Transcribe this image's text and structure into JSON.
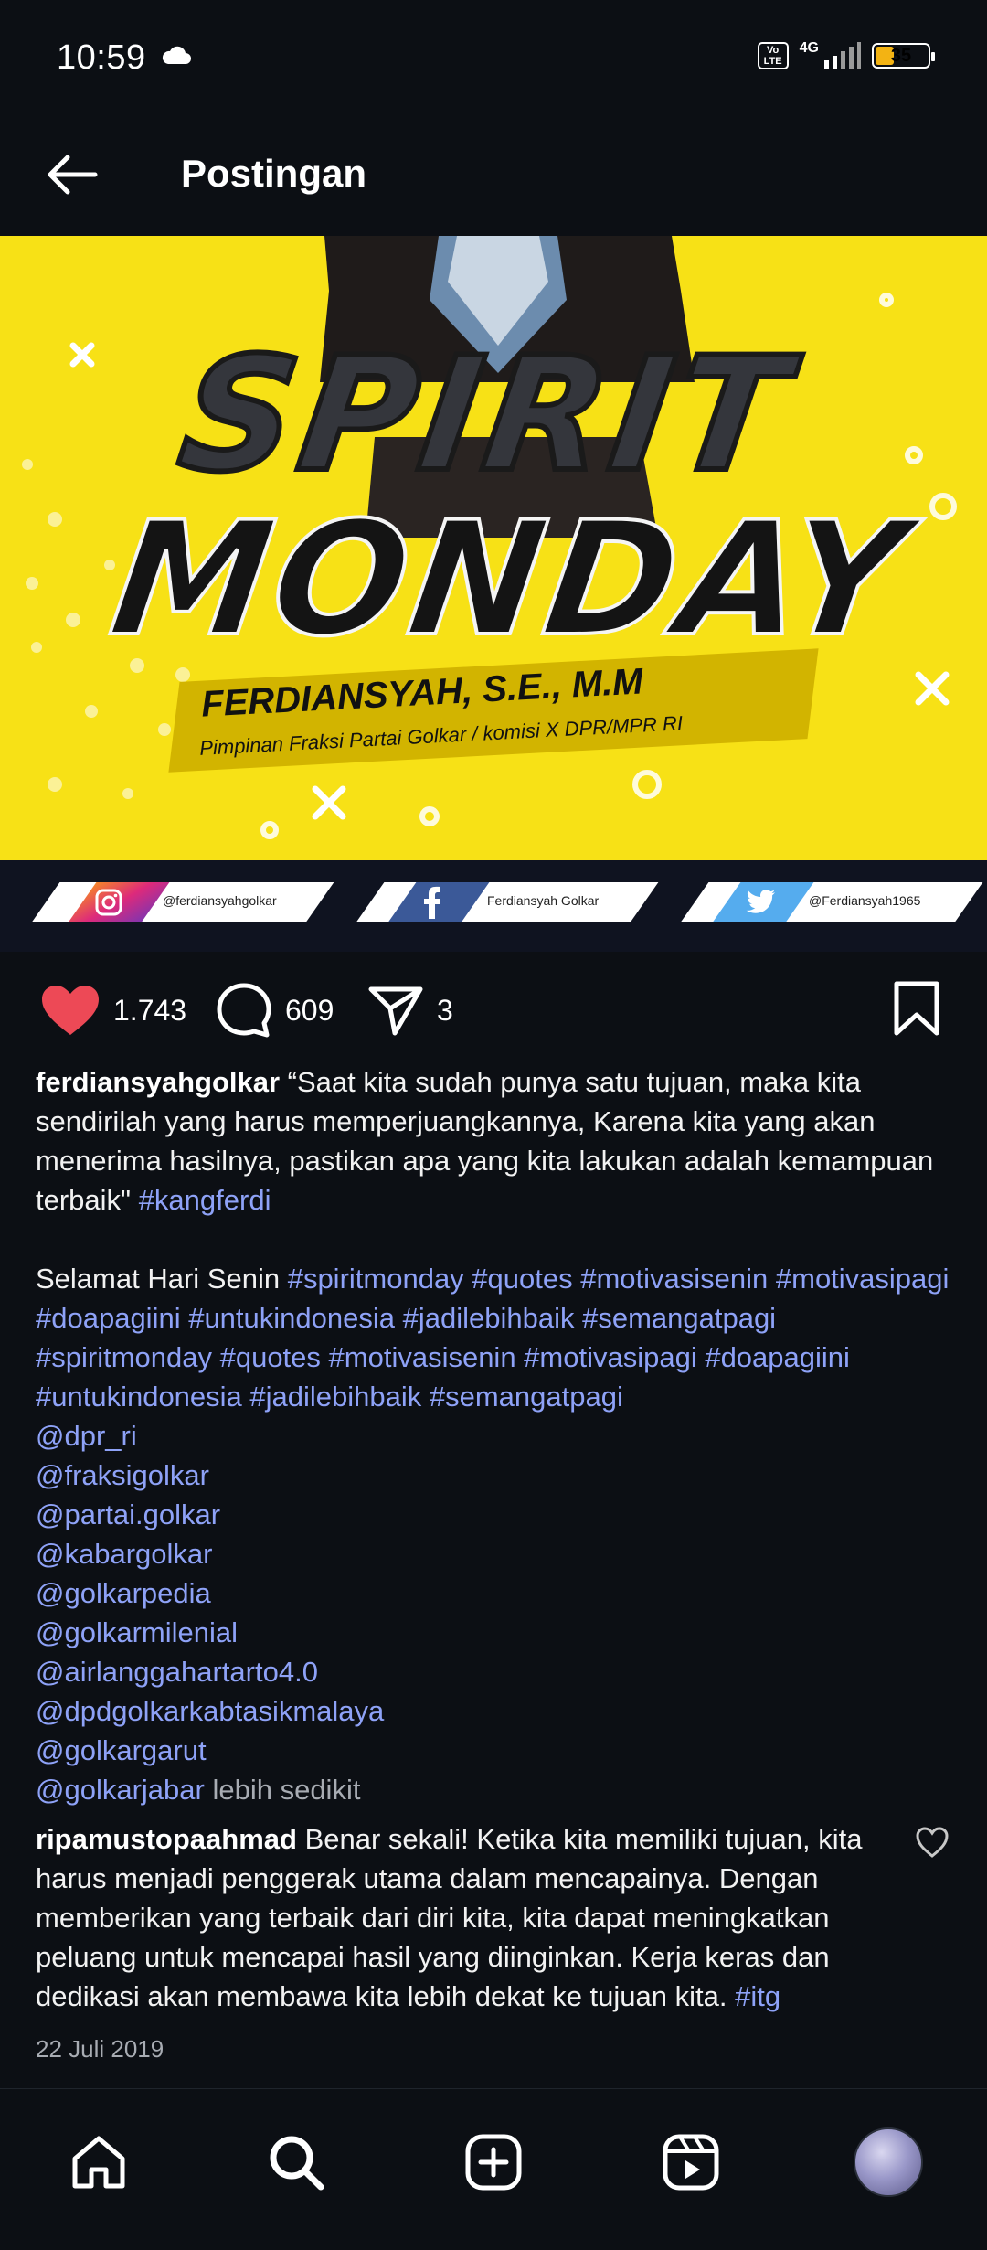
{
  "status_bar": {
    "time": "10:59",
    "network": "4G",
    "volte": "Vo LTE",
    "battery": "35"
  },
  "header": {
    "title": "Postingan"
  },
  "post_image": {
    "line1": "SPIRIT",
    "line2": "MONDAY",
    "name": "FERDIANSYAH, S.E., M.M",
    "role": "Pimpinan Fraksi Partai Golkar / komisi X DPR/MPR RI",
    "social": [
      {
        "icon": "instagram-icon",
        "handle": "@ferdiansyahgolkar"
      },
      {
        "icon": "facebook-icon",
        "handle": "Ferdiansyah Golkar"
      },
      {
        "icon": "twitter-icon",
        "handle": "@Ferdiansyah1965"
      }
    ]
  },
  "actions": {
    "likes": "1.743",
    "comments": "609",
    "shares": "3"
  },
  "caption": {
    "username": "ferdiansyahgolkar",
    "text": "“Saat kita sudah punya satu tujuan, maka kita sendirilah yang harus memperjuangkannya, Karena kita yang akan menerima hasilnya, pastikan apa yang kita lakukan adalah kemampuan terbaik\"",
    "tag1": "#kangferdi",
    "greeting": "Selamat Hari Senin",
    "hashtags": "#spiritmonday #quotes #motivasisenin #motivasipagi #doapagiini #untukindonesia #jadilebihbaik #semangatpagi #spiritmonday #quotes #motivasisenin #motivasipagi #doapagiini #untukindonesia #jadilebihbaik #semangatpagi",
    "mentions": [
      "@dpr_ri",
      "@fraksigolkar",
      "@partai.golkar",
      "@kabargolkar",
      "@golkarpedia",
      "@golkarmilenial",
      "@airlanggahartarto4.0",
      "@dpdgolkarkabtasikmalaya",
      "@golkargarut",
      "@golkarjabar"
    ],
    "less": "lebih sedikit"
  },
  "comment": {
    "username": "ripamustopaahmad",
    "text": "Benar sekali! Ketika kita memiliki tujuan, kita harus menjadi penggerak utama dalam mencapainya. Dengan memberikan yang terbaik dari diri kita, kita dapat meningkatkan peluang untuk mencapai hasil yang diinginkan. Kerja keras dan dedikasi akan membawa kita lebih dekat ke tujuan kita.",
    "tag": "#itg"
  },
  "date": "22 Juli 2019",
  "colors": {
    "like_red": "#ed4956",
    "link_blue": "#8ea2f7",
    "banner_yellow": "#f7e116",
    "background": "#0c0f14"
  }
}
